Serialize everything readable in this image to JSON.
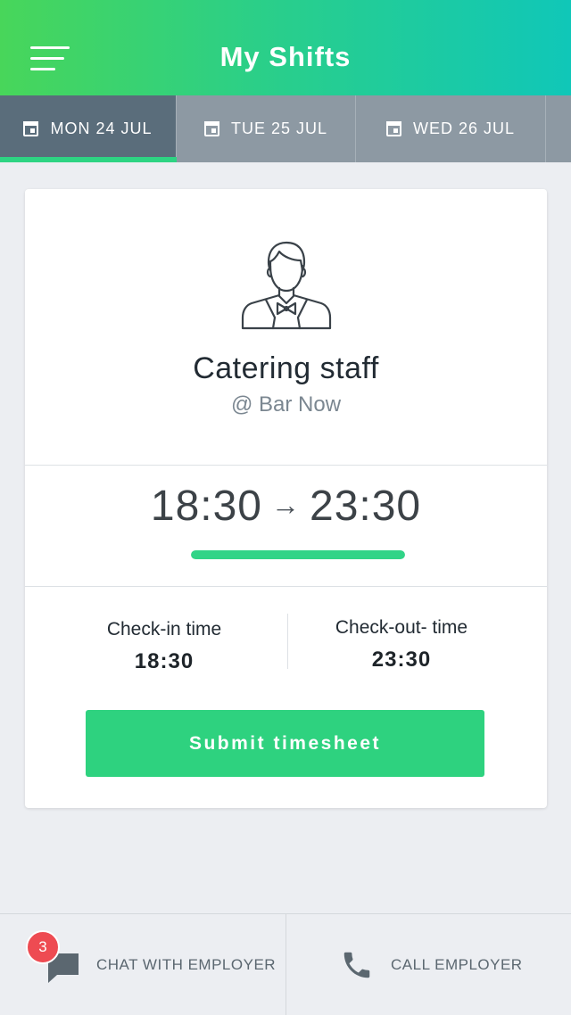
{
  "header": {
    "title": "My Shifts",
    "menu_icon": "hamburger-icon"
  },
  "tabs": [
    {
      "label": "MON 24 JUL",
      "icon": "calendar-icon",
      "active": true
    },
    {
      "label": "TUE 25 JUL",
      "icon": "calendar-icon",
      "active": false
    },
    {
      "label": "WED 26 JUL",
      "icon": "calendar-icon",
      "active": false
    }
  ],
  "shift": {
    "avatar_icon": "waiter-person-icon",
    "role": "Catering staff",
    "venue": "@ Bar Now",
    "start": "18:30",
    "arrow": "→",
    "end": "23:30",
    "progress": 1.0,
    "checkin_label": "Check-in time",
    "checkin_value": "18:30",
    "checkout_label": "Check-out- time",
    "checkout_value": "23:30",
    "submit_label": "Submit timesheet"
  },
  "bottom": {
    "chat_label": "CHAT WITH EMPLOYER",
    "chat_badge": "3",
    "chat_icon": "chat-bubble-icon",
    "call_label": "CALL EMPLOYER",
    "call_icon": "phone-icon"
  },
  "colors": {
    "accent": "#2ed27f",
    "active_tab": "#5a6d7b",
    "tab_bar": "#8d99a3",
    "badge": "#ee4b52"
  }
}
